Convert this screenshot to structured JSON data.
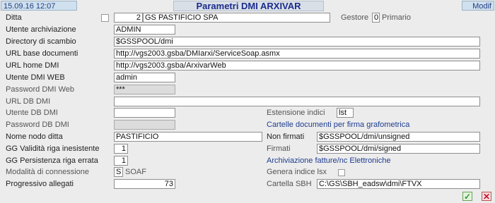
{
  "header": {
    "date": "15.09.16 12:07",
    "title": "Parametri  DMI ARXIVAR",
    "mode": "Modif"
  },
  "ditta": {
    "label": "Ditta",
    "code": "2",
    "name": "GS PASTIFICIO SPA"
  },
  "gestore": {
    "label": "Gestore",
    "value": "0",
    "primario": "Primario"
  },
  "left": {
    "utente_archiviazione": {
      "label": "Utente archiviazione",
      "value": "ADMIN"
    },
    "directory_scambio": {
      "label": "Directory di scambio",
      "value": "$GSSPOOL/dmi"
    },
    "url_base_documenti": {
      "label": "URL base documenti",
      "value": "http://vgs2003.gsba/DMIarxi/ServiceSoap.asmx"
    },
    "url_home_dmi": {
      "label": "URL home DMI",
      "value": "http://vgs2003.gsba/ArxivarWeb"
    },
    "utente_dmi_web": {
      "label": "Utente DMI WEB",
      "value": "admin"
    },
    "password_dmi_web": {
      "label": "Password DMI Web",
      "value": "***"
    },
    "url_db_dmi": {
      "label": "URL DB DMI",
      "value": ""
    },
    "utente_db_dmi": {
      "label": "Utente DB DMI",
      "value": ""
    },
    "password_db_dmi": {
      "label": "Password DB  DMI",
      "value": ""
    },
    "nome_nodo_ditta": {
      "label": "Nome nodo ditta",
      "value": "PASTIFICIO"
    },
    "gg_validita": {
      "label": "GG Validità riga inesistente",
      "value": "1"
    },
    "gg_persistenza": {
      "label": "GG Persistenza riga errata",
      "value": "1"
    },
    "modalita_connessione": {
      "label": "Modalità di connessione",
      "value": "S",
      "text": "SOAF"
    },
    "progressivo_allegati": {
      "label": "Progressivo allegati",
      "value": "73"
    }
  },
  "right": {
    "estensione_indici": {
      "label": "Estensione indici",
      "value": "lst"
    },
    "cartelle_heading": "Cartelle documenti per firma grafometrica",
    "non_firmati": {
      "label": "Non firmati",
      "value": "$GSSPOOL/dmi/unsigned"
    },
    "firmati": {
      "label": "Firmati",
      "value": "$GSSPOOL/dmi/signed"
    },
    "archiviazione_heading": "Archiviazione fatture/nc Elettroniche",
    "genera_indice": {
      "label": "Genera indice lsx",
      "checked": false
    },
    "cartella_sbh": {
      "label": "Cartella SBH",
      "value": "C:\\GS\\SBH_eadsw\\dmi\\FTVX"
    }
  },
  "buttons": {
    "confirm": "✓",
    "cancel": "✕"
  }
}
